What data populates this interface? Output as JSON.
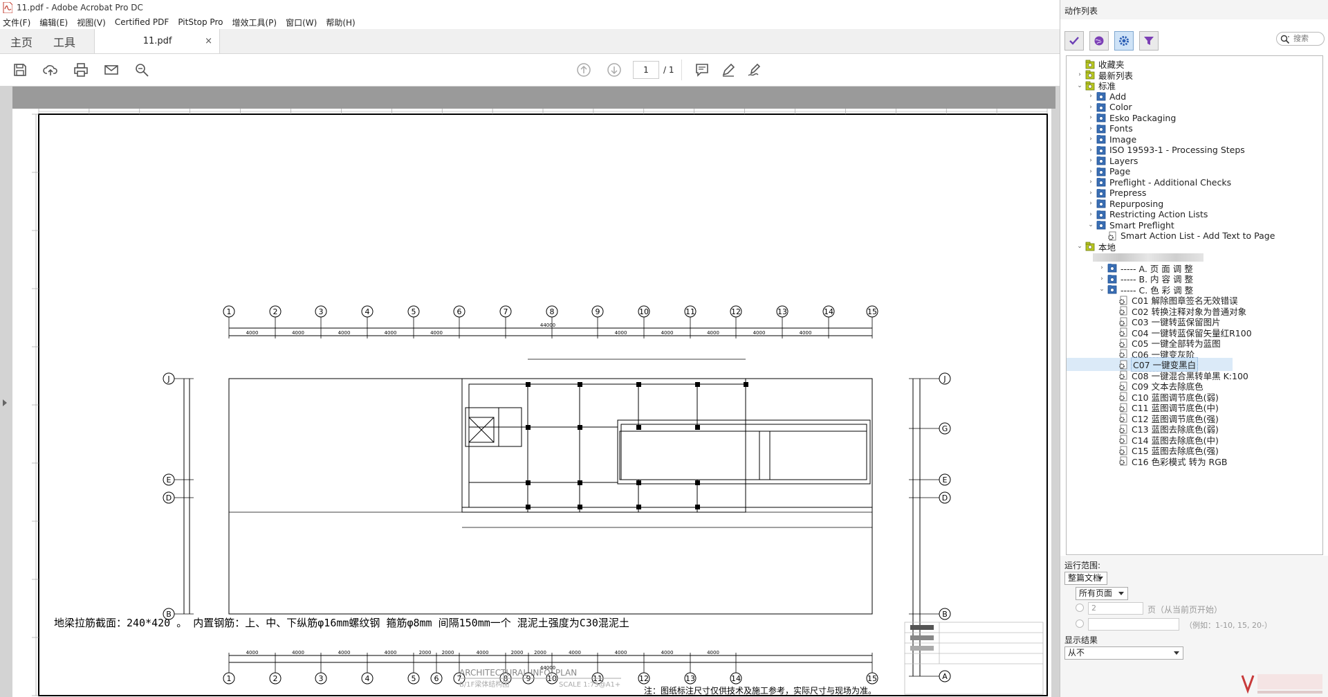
{
  "window": {
    "title": "11.pdf - Adobe Acrobat Pro DC"
  },
  "menu": [
    "文件(F)",
    "编辑(E)",
    "视图(V)",
    "Certified PDF",
    "PitStop Pro",
    "增效工具(P)",
    "窗口(W)",
    "帮助(H)"
  ],
  "tabs": {
    "home": "主页",
    "tools": "工具",
    "document": "11.pdf",
    "close": "×"
  },
  "toolbar": {
    "page_current": "1",
    "page_total": "/ 1"
  },
  "drawing": {
    "axis_top_numbers": [
      "1",
      "2",
      "3",
      "4",
      "5",
      "6",
      "7",
      "8",
      "9",
      "10",
      "11",
      "12",
      "13",
      "14",
      "15"
    ],
    "axis_bottom_numbers": [
      "1",
      "2",
      "3",
      "4",
      "5",
      "6",
      "7",
      "8",
      "9",
      "10",
      "11",
      "12",
      "13",
      "14",
      "15"
    ],
    "axis_left_letters": [
      "J",
      "E",
      "D",
      "B"
    ],
    "axis_right_letters": [
      "J",
      "G",
      "E",
      "D",
      "B",
      "A"
    ],
    "top_total_dim": "44000",
    "top_dims": [
      "4000",
      "4000",
      "4000",
      "4000",
      "4000",
      "4000",
      "4000",
      "4000",
      "4000",
      "4000"
    ],
    "bottom_total_dim": "44000",
    "bottom_dims": [
      "4000",
      "4000",
      "4000",
      "4000",
      "2000",
      "2000",
      "4000",
      "2000",
      "2000",
      "4000",
      "4000",
      "4000",
      "4000"
    ],
    "note_main": "地梁拉筋截面：240*420 。 内置钢筋：上、中、下纵筋φ16mm螺纹钢    箍筋φ8mm 间隔150mm一个    混泥土强度为C30混泥土",
    "plan_title": "ARCHITECTURAL INFO. PLAN",
    "plan_subtitle": "B/1F梁体结构图",
    "plan_scale": "SCALE 1:75@A1+",
    "footnote": "注：图纸标注尺寸仅供技术及施工参考，实际尺寸与现场为准。"
  },
  "panel": {
    "title": "动作列表",
    "search_placeholder": "搜索",
    "tree": [
      {
        "label": "收藏夹",
        "level": 0,
        "arrow": "",
        "icon": "folder"
      },
      {
        "label": "最新列表",
        "level": 0,
        "arrow": "›",
        "icon": "folder"
      },
      {
        "label": "标准",
        "level": 0,
        "arrow": "⌄",
        "icon": "folder"
      },
      {
        "label": "Add",
        "level": 1,
        "arrow": "›",
        "icon": "set"
      },
      {
        "label": "Color",
        "level": 1,
        "arrow": "›",
        "icon": "set"
      },
      {
        "label": "Esko Packaging",
        "level": 1,
        "arrow": "›",
        "icon": "set"
      },
      {
        "label": "Fonts",
        "level": 1,
        "arrow": "›",
        "icon": "set"
      },
      {
        "label": "Image",
        "level": 1,
        "arrow": "›",
        "icon": "set"
      },
      {
        "label": "ISO 19593-1 - Processing Steps",
        "level": 1,
        "arrow": "›",
        "icon": "set"
      },
      {
        "label": "Layers",
        "level": 1,
        "arrow": "›",
        "icon": "set"
      },
      {
        "label": "Page",
        "level": 1,
        "arrow": "›",
        "icon": "set"
      },
      {
        "label": "Preflight - Additional Checks",
        "level": 1,
        "arrow": "›",
        "icon": "set"
      },
      {
        "label": "Prepress",
        "level": 1,
        "arrow": "›",
        "icon": "set"
      },
      {
        "label": "Repurposing",
        "level": 1,
        "arrow": "›",
        "icon": "set"
      },
      {
        "label": "Restricting Action Lists",
        "level": 1,
        "arrow": "›",
        "icon": "set"
      },
      {
        "label": "Smart Preflight",
        "level": 1,
        "arrow": "⌄",
        "icon": "set"
      },
      {
        "label": "Smart Action List - Add Text to Page",
        "level": 2,
        "arrow": "",
        "icon": "action"
      },
      {
        "label": "本地",
        "level": 0,
        "arrow": "⌄",
        "icon": "folder"
      },
      {
        "label": "",
        "level": 1,
        "arrow": "",
        "icon": "blur"
      },
      {
        "label": "----- A. 页 面 调 整",
        "level": 2,
        "arrow": "›",
        "icon": "set"
      },
      {
        "label": "----- B. 内 容 调 整",
        "level": 2,
        "arrow": "›",
        "icon": "set"
      },
      {
        "label": "----- C. 色 彩 调 整",
        "level": 2,
        "arrow": "⌄",
        "icon": "set"
      },
      {
        "label": "C01 解除图章签名无效错误",
        "level": 3,
        "arrow": "",
        "icon": "action"
      },
      {
        "label": "C02 转换注释对象为普通对象",
        "level": 3,
        "arrow": "",
        "icon": "action"
      },
      {
        "label": "C03 一键转蓝保留图片",
        "level": 3,
        "arrow": "",
        "icon": "action"
      },
      {
        "label": "C04 一键转蓝保留矢量红R100",
        "level": 3,
        "arrow": "",
        "icon": "action"
      },
      {
        "label": "C05 一键全部转为蓝图",
        "level": 3,
        "arrow": "",
        "icon": "action"
      },
      {
        "label": "C06 一键变灰阶",
        "level": 3,
        "arrow": "",
        "icon": "action"
      },
      {
        "label": "C07 一键变黑白",
        "level": 3,
        "arrow": "",
        "icon": "action",
        "selected": true
      },
      {
        "label": "C08 一键混合黑转单黑 K:100",
        "level": 3,
        "arrow": "",
        "icon": "action"
      },
      {
        "label": "C09 文本去除底色",
        "level": 3,
        "arrow": "",
        "icon": "action"
      },
      {
        "label": "C10 蓝图调节底色(弱)",
        "level": 3,
        "arrow": "",
        "icon": "action"
      },
      {
        "label": "C11 蓝图调节底色(中)",
        "level": 3,
        "arrow": "",
        "icon": "action"
      },
      {
        "label": "C12 蓝图调节底色(强)",
        "level": 3,
        "arrow": "",
        "icon": "action"
      },
      {
        "label": "C13 蓝图去除底色(弱)",
        "level": 3,
        "arrow": "",
        "icon": "action"
      },
      {
        "label": "C14 蓝图去除底色(中)",
        "level": 3,
        "arrow": "",
        "icon": "action"
      },
      {
        "label": "C15 蓝图去除底色(强)",
        "level": 3,
        "arrow": "",
        "icon": "action"
      },
      {
        "label": "C16 色彩模式 转为 RGB",
        "level": 3,
        "arrow": "",
        "icon": "action"
      }
    ],
    "run_scope_label": "运行范围:",
    "run_scope_value": "整篇文档",
    "pages_value": "所有页面",
    "page_count": "2",
    "page_count_hint": "页（从当前页开始）",
    "range_hint": "（例如：1-10, 15, 20-）",
    "show_results_label": "显示结果",
    "show_results_value": "从不"
  },
  "colors": {
    "accent": "#2d6fb5",
    "folder": "#b9c820",
    "set": "#3a6fb5"
  }
}
